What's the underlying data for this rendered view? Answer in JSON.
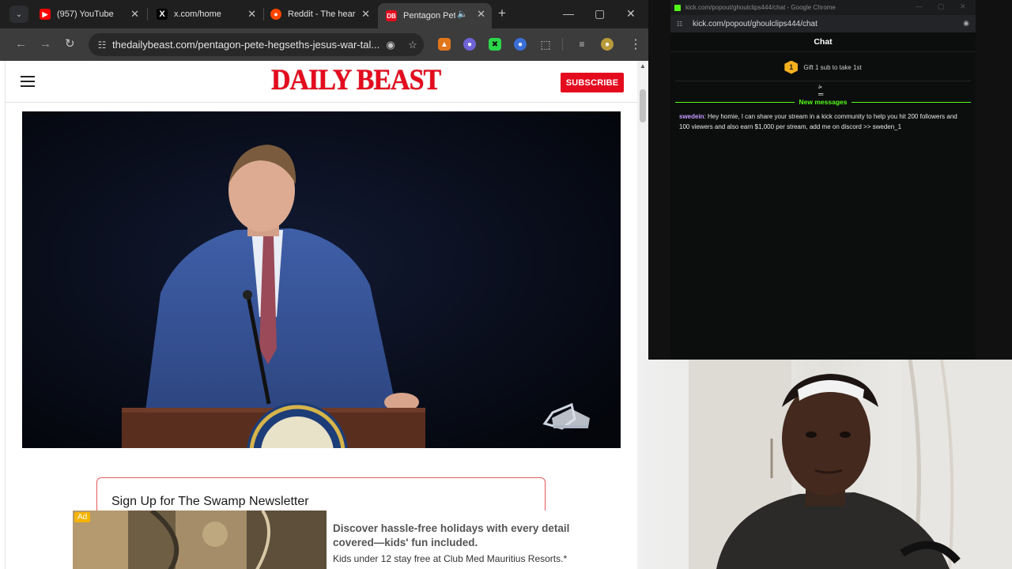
{
  "browser": {
    "tabs": [
      {
        "title": "(957) YouTube",
        "favicon": "youtube-icon",
        "color": "#ff0000",
        "active": false
      },
      {
        "title": "x.com/home",
        "favicon": "x-icon",
        "color": "#000000",
        "active": false
      },
      {
        "title": "Reddit - The hear",
        "favicon": "reddit-icon",
        "color": "#ff4500",
        "active": false
      },
      {
        "title": "Pentagon Pet",
        "favicon": "daily-beast-icon",
        "color": "#e40b1e",
        "active": true
      }
    ],
    "url": "thedailybeast.com/pentagon-pete-hegseths-jesus-war-tal..."
  },
  "site": {
    "logo_text": "DAILY BEAST",
    "subscribe_label": "SUBSCRIBE",
    "newsletter_title": "Sign Up for The Swamp Newsletter",
    "ad": {
      "badge": "Ad",
      "headline": "Discover hassle-free holidays with every detail covered—kids' fun included.",
      "subtext": "Kids under 12 stay free at Club Med Mauritius Resorts.*"
    }
  },
  "chat_window": {
    "window_title": "kick.com/popout/ghoulclips444/chat - Google Chrome",
    "url": "kick.com/popout/ghoulclips444/chat",
    "header": "Chat",
    "gift_badge": "1",
    "gift_text": "Gift 1 sub to take 1st",
    "new_messages_label": "New messages",
    "messages": [
      {
        "user": "swedein",
        "text": "Hey homie, I can share your stream in a kick community to help you hit 200 followers and 100 viewers and also earn $1,000 per stream, add me on discord >> sweden_1"
      }
    ]
  },
  "colors": {
    "brand_red": "#e40b1e",
    "kick_green": "#53fc18",
    "chat_user": "#c79bff"
  }
}
